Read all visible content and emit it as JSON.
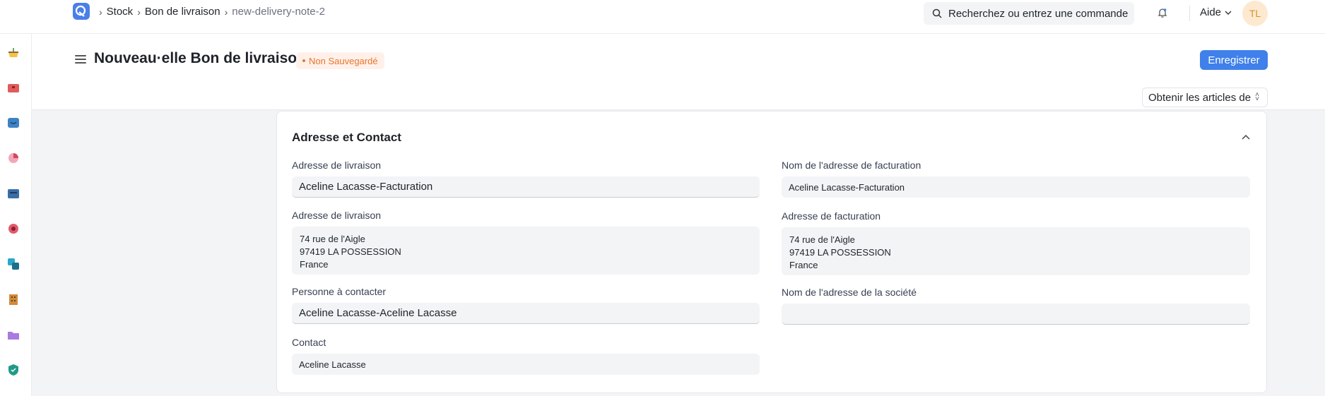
{
  "breadcrumb": {
    "items": [
      "Stock",
      "Bon de livraison",
      "new-delivery-note-2"
    ]
  },
  "search": {
    "placeholder": "Recherchez ou entrez une commande"
  },
  "help": {
    "label": "Aide"
  },
  "user": {
    "initials": "TL"
  },
  "page": {
    "title": "Nouveau·elle Bon de livraison",
    "status": "Non Sauvegardé",
    "save_label": "Enregistrer",
    "get_items_label": "Obtenir les articles de"
  },
  "section": {
    "title": "Adresse et Contact",
    "left": {
      "shipping_address_label": "Adresse de livraison",
      "shipping_address_value": "Aceline Lacasse-Facturation",
      "shipping_address_display_label": "Adresse de livraison",
      "shipping_address_display": "74 rue de l'Aigle\n97419 LA POSSESSION\nFrance",
      "contact_person_label": "Personne à contacter",
      "contact_person_value": "Aceline Lacasse-Aceline Lacasse",
      "contact_label": "Contact",
      "contact_value": "Aceline Lacasse"
    },
    "right": {
      "billing_name_label": "Nom de l'adresse de facturation",
      "billing_name_value": "Aceline Lacasse-Facturation",
      "billing_address_label": "Adresse de facturation",
      "billing_address_display": "74 rue de l'Aigle\n97419 LA POSSESSION\nFrance",
      "company_address_label": "Nom de l'adresse de la société",
      "company_address_value": ""
    }
  },
  "sidebar": {
    "icons": [
      "stock-icon",
      "selling-icon",
      "buying-icon",
      "reports-icon",
      "accounting-icon",
      "crm-icon",
      "assets-icon",
      "hr-icon",
      "projects-icon",
      "quality-icon"
    ]
  },
  "colors": {
    "primary": "#3f80ea",
    "status": "#e8762c",
    "status_bg": "#fff1ea",
    "avatar_bg": "#fde9cf"
  }
}
